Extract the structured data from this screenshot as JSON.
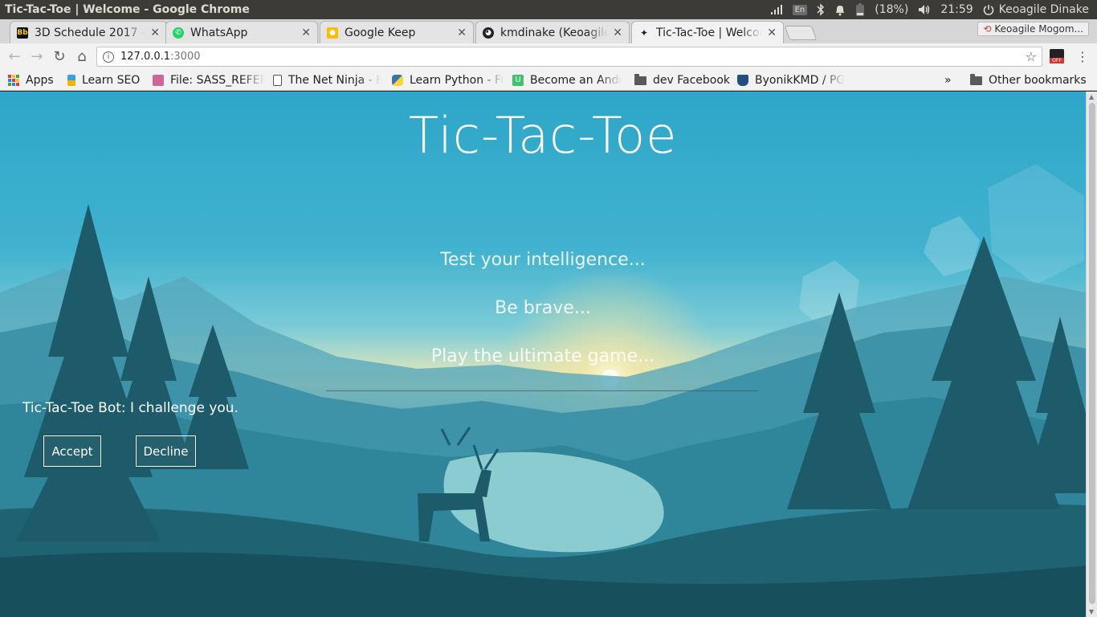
{
  "window": {
    "title": "Tic-Tac-Toe | Welcome - Google Chrome"
  },
  "system_tray": {
    "keyboard": "En",
    "battery": "(18%)",
    "time": "21:59",
    "user": "Keoagile Dinake",
    "icons": [
      "signal-icon",
      "keyboard-icon",
      "bluetooth-icon",
      "bell-icon",
      "battery-icon",
      "volume-icon",
      "power-icon"
    ]
  },
  "tabs": [
    {
      "label": "3D Schedule 2017 – ",
      "icon": "bb-favicon",
      "active": false
    },
    {
      "label": "WhatsApp",
      "icon": "whatsapp-favicon",
      "active": false
    },
    {
      "label": "Google Keep",
      "icon": "keep-favicon",
      "active": false
    },
    {
      "label": "kmdinake (Keoagile",
      "icon": "github-favicon",
      "active": false
    },
    {
      "label": "Tic-Tac-Toe | Welcom",
      "icon": "tictactoe-favicon",
      "active": true
    }
  ],
  "profile_chip": "Keoagile Mogom...",
  "address_bar": {
    "host": "127.0.0.1",
    "port": ":3000"
  },
  "bookmarks": [
    {
      "label": "Apps",
      "icon": "apps-grid-icon"
    },
    {
      "label": "Learn SEO",
      "icon": "seo-icon"
    },
    {
      "label": "File: SASS_REFER",
      "icon": "sass-icon"
    },
    {
      "label": "The Net Ninja - B",
      "icon": "page-icon"
    },
    {
      "label": "Learn Python - Fr",
      "icon": "python-icon"
    },
    {
      "label": "Become an Andr",
      "icon": "udacity-icon"
    },
    {
      "label": "dev Facebook",
      "icon": "folder-icon"
    },
    {
      "label": "ByonikKMD / PG",
      "icon": "bitbucket-icon"
    }
  ],
  "bookmarks_overflow": "»",
  "other_bookmarks": "Other bookmarks",
  "page": {
    "title": "Tic-Tac-Toe",
    "taglines": [
      "Test your intelligence...",
      "Be brave...",
      "Play the ultimate game..."
    ],
    "bot_message": "Tic-Tac-Toe Bot: I challenge you.",
    "accept_label": "Accept",
    "decline_label": "Decline"
  }
}
